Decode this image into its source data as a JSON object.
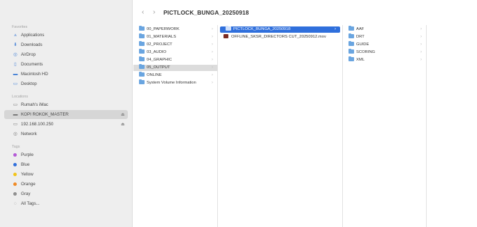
{
  "window": {
    "title": "PICTLOCK_BUNGA_20250918"
  },
  "toolbar": {
    "back_icon": "chevron-left-icon",
    "forward_icon": "chevron-right-icon"
  },
  "sidebar": {
    "favorites_label": "Favorites",
    "favorites": [
      {
        "label": "Applications",
        "icon": "applications-icon"
      },
      {
        "label": "Downloads",
        "icon": "downloads-icon"
      },
      {
        "label": "AirDrop",
        "icon": "airdrop-icon"
      },
      {
        "label": "Documents",
        "icon": "documents-icon"
      },
      {
        "label": "Macintosh HD",
        "icon": "hard-drive-icon"
      },
      {
        "label": "Desktop",
        "icon": "desktop-icon"
      }
    ],
    "locations_label": "Locations",
    "locations": [
      {
        "label": "Rumah's iMac",
        "icon": "computer-icon"
      },
      {
        "label": "KOPI ROKOK_MASTER",
        "icon": "drive-icon",
        "selected": true
      },
      {
        "label": "192.168.100.250",
        "icon": "monitor-icon"
      },
      {
        "label": "Network",
        "icon": "network-icon"
      }
    ],
    "tags_label": "Tags",
    "tags": [
      {
        "label": "Purple",
        "color": "#b45ad6"
      },
      {
        "label": "Blue",
        "color": "#2f6fdc"
      },
      {
        "label": "Yellow",
        "color": "#f2c318"
      },
      {
        "label": "Orange",
        "color": "#f08a24"
      },
      {
        "label": "Gray",
        "color": "#8e8e8e"
      },
      {
        "label": "All Tags...",
        "color": ""
      }
    ]
  },
  "columns": [
    {
      "items": [
        {
          "label": "00_PAPERWORK"
        },
        {
          "label": "01_MATERIALS"
        },
        {
          "label": "02_PROJECT"
        },
        {
          "label": "03_AUDIO"
        },
        {
          "label": "04_GRAPHIC"
        },
        {
          "label": "05_OUTPUT",
          "selected": "gray"
        },
        {
          "label": "ONLINE"
        },
        {
          "label": "System Volume Information"
        }
      ]
    },
    {
      "items": [
        {
          "label": "PICTLOCK_BUNGA_20250918",
          "selected": "blue"
        },
        {
          "label": "OFFLINE_SKSR_DIRECTORS CUT_20250912.mov",
          "type": "video"
        }
      ]
    },
    {
      "items": [
        {
          "label": "AAF"
        },
        {
          "label": "DRT"
        },
        {
          "label": "GUIDE"
        },
        {
          "label": "SCORING"
        },
        {
          "label": "XML"
        }
      ]
    }
  ]
}
